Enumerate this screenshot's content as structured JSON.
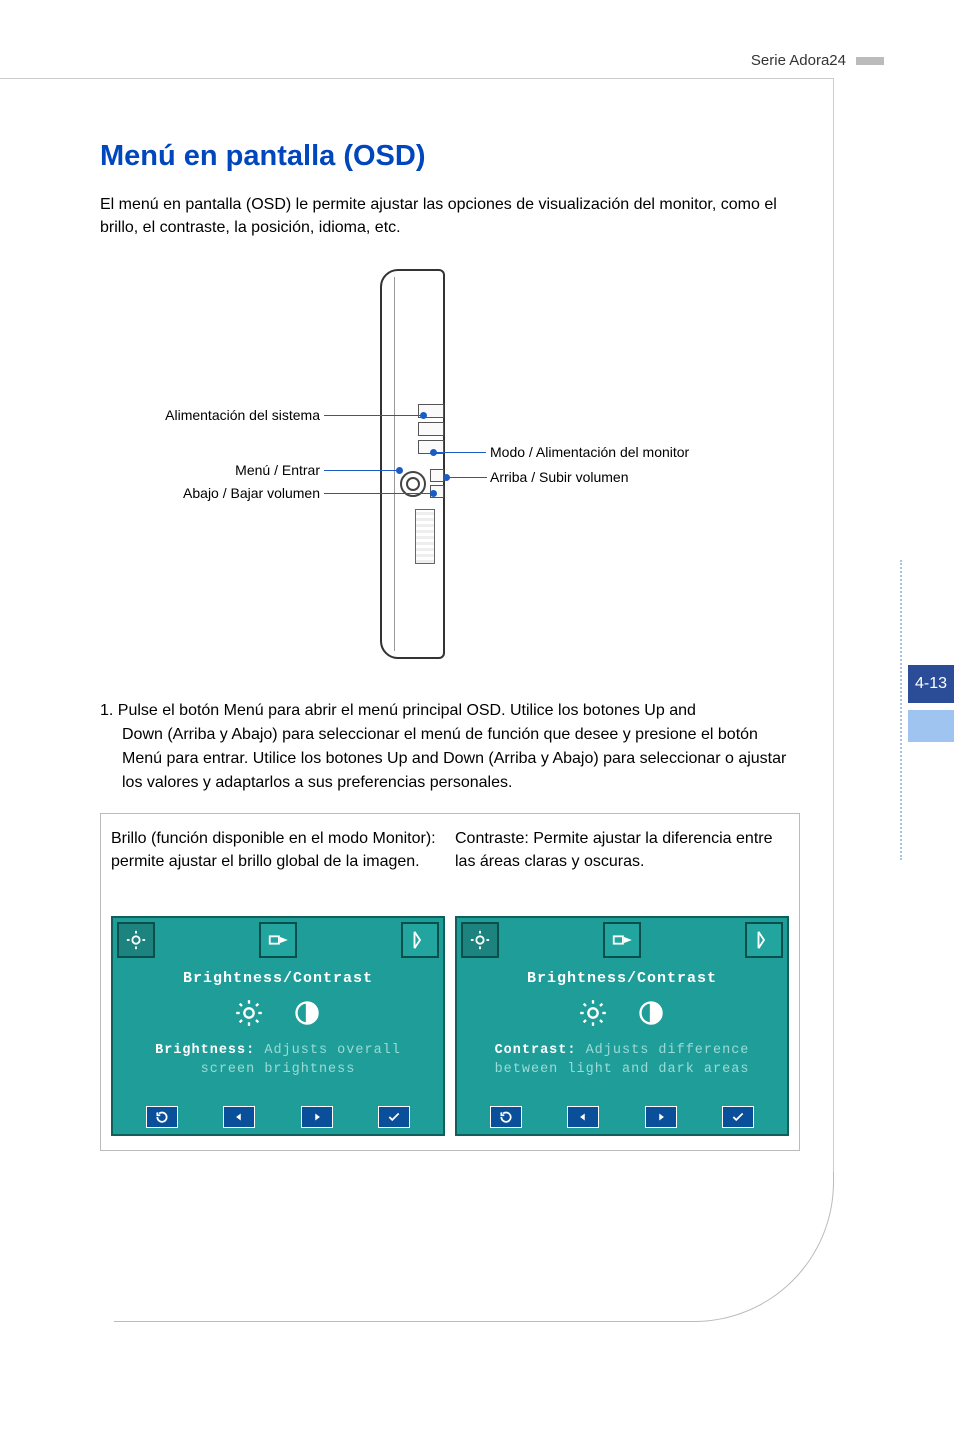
{
  "header": {
    "series": "Serie Adora24"
  },
  "page": {
    "number": "4-13"
  },
  "title": "Menú en pantalla (OSD)",
  "intro": "El menú en pantalla (OSD) le permite ajustar las opciones de visualización del monitor, como el brillo, el contraste, la posición, idioma, etc.",
  "callouts": {
    "l1": "Alimentación del sistema",
    "l2": "Menú / Entrar",
    "l3": "Abajo / Bajar volumen",
    "r1": "Modo / Alimentación del monitor",
    "r2": "Arriba / Subir volumen"
  },
  "step": {
    "num": "1.",
    "text_first": "Pulse el botón Menú para abrir el menú principal OSD. Utilice los botones Up and",
    "text_rest": "Down (Arriba y Abajo) para seleccionar el menú de función que desee y presione el botón Menú para entrar. Utilice los botones Up and Down (Arriba y Abajo) para seleccionar o ajustar los valores y adaptarlos a sus preferencias personales."
  },
  "osd": {
    "left": {
      "desc": "Brillo (función disponible en el modo Monitor): permite ajustar el brillo global de la imagen.",
      "title": "Brightness/Contrast",
      "line1_hl": "Brightness:",
      "line1_rest": " Adjusts overall",
      "line2": "screen brightness"
    },
    "right": {
      "desc": "Contraste: Permite ajustar la diferencia entre las áreas claras y oscuras.",
      "title": "Brightness/Contrast",
      "line1_hl": "Contrast:",
      "line1_rest": " Adjusts difference",
      "line2": "between light and dark areas"
    }
  }
}
